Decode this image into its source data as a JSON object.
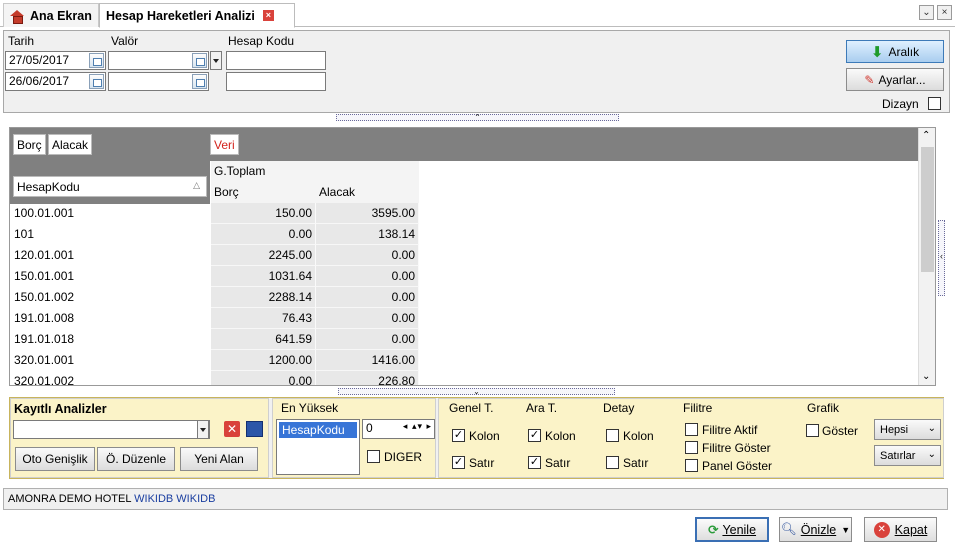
{
  "tabs": [
    {
      "label": "Ana Ekran"
    },
    {
      "label": "Hesap Hareketleri Analizi"
    }
  ],
  "filters": {
    "tarih_label": "Tarih",
    "valor_label": "Valör",
    "hesap_kodu_label": "Hesap Kodu",
    "tarih_from": "27/05/2017",
    "tarih_to": "26/06/2017",
    "valor_from": "",
    "valor_to": "",
    "hesap_kodu_from": "",
    "hesap_kodu_to": ""
  },
  "buttons": {
    "aralik": "Aralık",
    "ayarlar": "Ayarlar...",
    "dizayn": "Dizayn"
  },
  "grid": {
    "filter_fields": [
      "Borç",
      "Alacak"
    ],
    "data_field": "Veri",
    "row_field": "HesapKodu",
    "column_group": "G.Toplam",
    "columns": [
      "Borç",
      "Alacak"
    ],
    "rows": [
      {
        "kod": "100.01.001",
        "borc": "150.00",
        "alacak": "3595.00"
      },
      {
        "kod": "101",
        "borc": "0.00",
        "alacak": "138.14"
      },
      {
        "kod": "120.01.001",
        "borc": "2245.00",
        "alacak": "0.00"
      },
      {
        "kod": "150.01.001",
        "borc": "1031.64",
        "alacak": "0.00"
      },
      {
        "kod": "150.01.002",
        "borc": "2288.14",
        "alacak": "0.00"
      },
      {
        "kod": "191.01.008",
        "borc": "76.43",
        "alacak": "0.00"
      },
      {
        "kod": "191.01.018",
        "borc": "641.59",
        "alacak": "0.00"
      },
      {
        "kod": "320.01.001",
        "borc": "1200.00",
        "alacak": "1416.00"
      },
      {
        "kod": "320.01.002",
        "borc": "0.00",
        "alacak": "226.80"
      }
    ]
  },
  "analysis": {
    "saved_title": "Kayıtlı Analizler",
    "saved_value": "",
    "oto_genislik": "Oto Genişlik",
    "o_duzenle": "Ö. Düzenle",
    "yeni_alan": "Yeni Alan",
    "en_yuksek": "En Yüksek",
    "en_yuksek_item": "HesapKodu",
    "en_yuksek_count": "0",
    "diger": "DIGER",
    "genel_t": "Genel T.",
    "ara_t": "Ara T.",
    "detay": "Detay",
    "kolon": "Kolon",
    "satir": "Satır",
    "filitre": "Filitre",
    "filitre_aktif": "Filitre Aktif",
    "filitre_goster": "Filitre Göster",
    "panel_goster": "Panel Göster",
    "grafik": "Grafik",
    "goster": "Göster",
    "hepsi": "Hepsi",
    "satirlar": "Satırlar"
  },
  "status": {
    "company": "AMONRA DEMO HOTEL",
    "db": "WIKIDB WIKIDB"
  },
  "footer": {
    "yenile": "Yenile",
    "onizle": "Önizle",
    "kapat": "Kapat"
  }
}
